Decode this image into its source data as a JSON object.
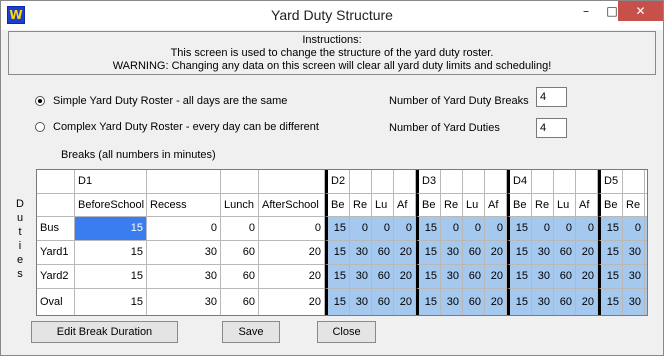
{
  "window": {
    "title": "Yard Duty Structure",
    "app_icon": "W",
    "minimize": "–",
    "maximize": "□",
    "close": "✕"
  },
  "instructions": {
    "heading": "Instructions:",
    "line1": "This screen is used to change the structure of the yard duty roster.",
    "line2": "WARNING: Changing any data on this screen will clear all yard duty limits and scheduling!"
  },
  "options": {
    "simple": {
      "label": "Simple Yard Duty Roster - all days are the same",
      "checked": true
    },
    "complex": {
      "label": "Complex Yard Duty Roster - every day can be different",
      "checked": false
    }
  },
  "fields": {
    "breaks_label": "Number of Yard Duty Breaks",
    "breaks_value": "4",
    "duties_label": "Number of Yard Duties",
    "duties_value": "4"
  },
  "grid": {
    "breaks_caption": "Breaks (all numbers in minutes)",
    "side_label": [
      "D",
      "u",
      "t",
      "i",
      "e",
      "s"
    ],
    "days": [
      "D1",
      "D2",
      "D3",
      "D4",
      "D5"
    ],
    "d1_columns": [
      "BeforeSchool",
      "Recess",
      "Lunch",
      "AfterSchool"
    ],
    "short_columns": [
      "Be",
      "Re",
      "Lu",
      "Af"
    ],
    "rows": [
      {
        "name": "Bus",
        "values": [
          "15",
          "0",
          "0",
          "0"
        ]
      },
      {
        "name": "Yard1",
        "values": [
          "15",
          "30",
          "60",
          "20"
        ]
      },
      {
        "name": "Yard2",
        "values": [
          "15",
          "30",
          "60",
          "20"
        ]
      },
      {
        "name": "Oval",
        "values": [
          "15",
          "30",
          "60",
          "20"
        ]
      }
    ]
  },
  "buttons": {
    "edit": "Edit Break Duration",
    "save": "Save",
    "close": "Close"
  },
  "colors": {
    "cell_blue": "#a5c8ef",
    "selected": "#3a7df0",
    "close_button": "#c7504a"
  }
}
